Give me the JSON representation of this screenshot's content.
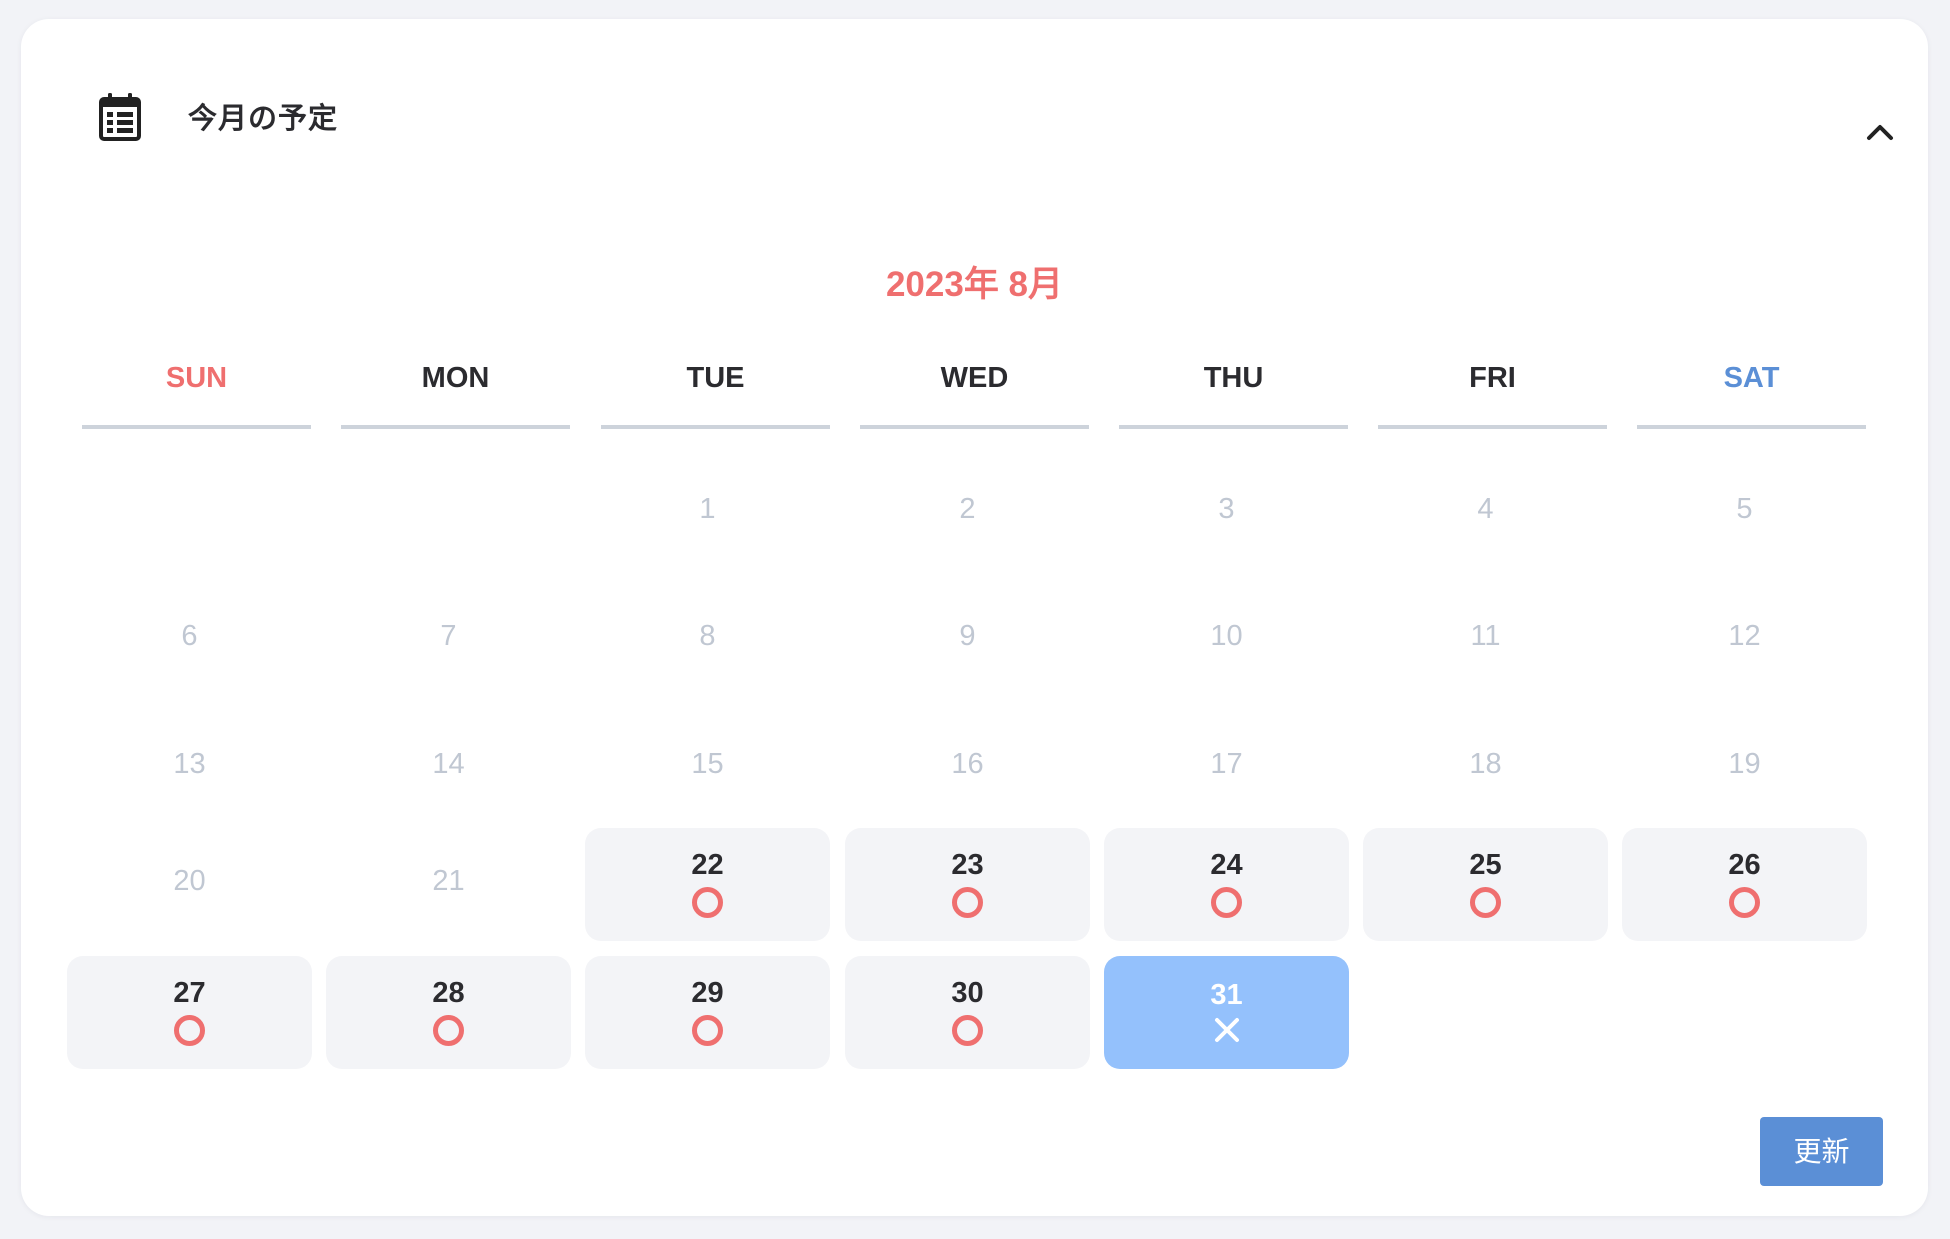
{
  "header": {
    "title": "今月の予定",
    "icon": "calendar-icon",
    "collapse_icon": "chevron-up-icon"
  },
  "calendar": {
    "month_label": "2023年 8月",
    "weekdays": [
      "SUN",
      "MON",
      "TUE",
      "WED",
      "THU",
      "FRI",
      "SAT"
    ],
    "weeks": [
      [
        null,
        null,
        {
          "day": "1",
          "state": "past"
        },
        {
          "day": "2",
          "state": "past"
        },
        {
          "day": "3",
          "state": "past"
        },
        {
          "day": "4",
          "state": "past"
        },
        {
          "day": "5",
          "state": "past"
        }
      ],
      [
        {
          "day": "6",
          "state": "past"
        },
        {
          "day": "7",
          "state": "past"
        },
        {
          "day": "8",
          "state": "past"
        },
        {
          "day": "9",
          "state": "past"
        },
        {
          "day": "10",
          "state": "past"
        },
        {
          "day": "11",
          "state": "past"
        },
        {
          "day": "12",
          "state": "past"
        }
      ],
      [
        {
          "day": "13",
          "state": "past"
        },
        {
          "day": "14",
          "state": "past"
        },
        {
          "day": "15",
          "state": "past"
        },
        {
          "day": "16",
          "state": "past"
        },
        {
          "day": "17",
          "state": "past"
        },
        {
          "day": "18",
          "state": "past"
        },
        {
          "day": "19",
          "state": "past"
        }
      ],
      [
        {
          "day": "20",
          "state": "past"
        },
        {
          "day": "21",
          "state": "past"
        },
        {
          "day": "22",
          "state": "available",
          "mark": "circle"
        },
        {
          "day": "23",
          "state": "available",
          "mark": "circle"
        },
        {
          "day": "24",
          "state": "available",
          "mark": "circle"
        },
        {
          "day": "25",
          "state": "available",
          "mark": "circle"
        },
        {
          "day": "26",
          "state": "available",
          "mark": "circle"
        }
      ],
      [
        {
          "day": "27",
          "state": "available",
          "mark": "circle"
        },
        {
          "day": "28",
          "state": "available",
          "mark": "circle"
        },
        {
          "day": "29",
          "state": "available",
          "mark": "circle"
        },
        {
          "day": "30",
          "state": "available",
          "mark": "circle"
        },
        {
          "day": "31",
          "state": "selected",
          "mark": "cross"
        },
        null,
        null
      ]
    ]
  },
  "actions": {
    "update_label": "更新"
  },
  "colors": {
    "accent_red": "#ef6f6f",
    "accent_blue": "#5b8fd6",
    "selected_bg": "#94c1fc",
    "available_bg": "#f3f4f7",
    "past_text": "#c0c7d2"
  }
}
